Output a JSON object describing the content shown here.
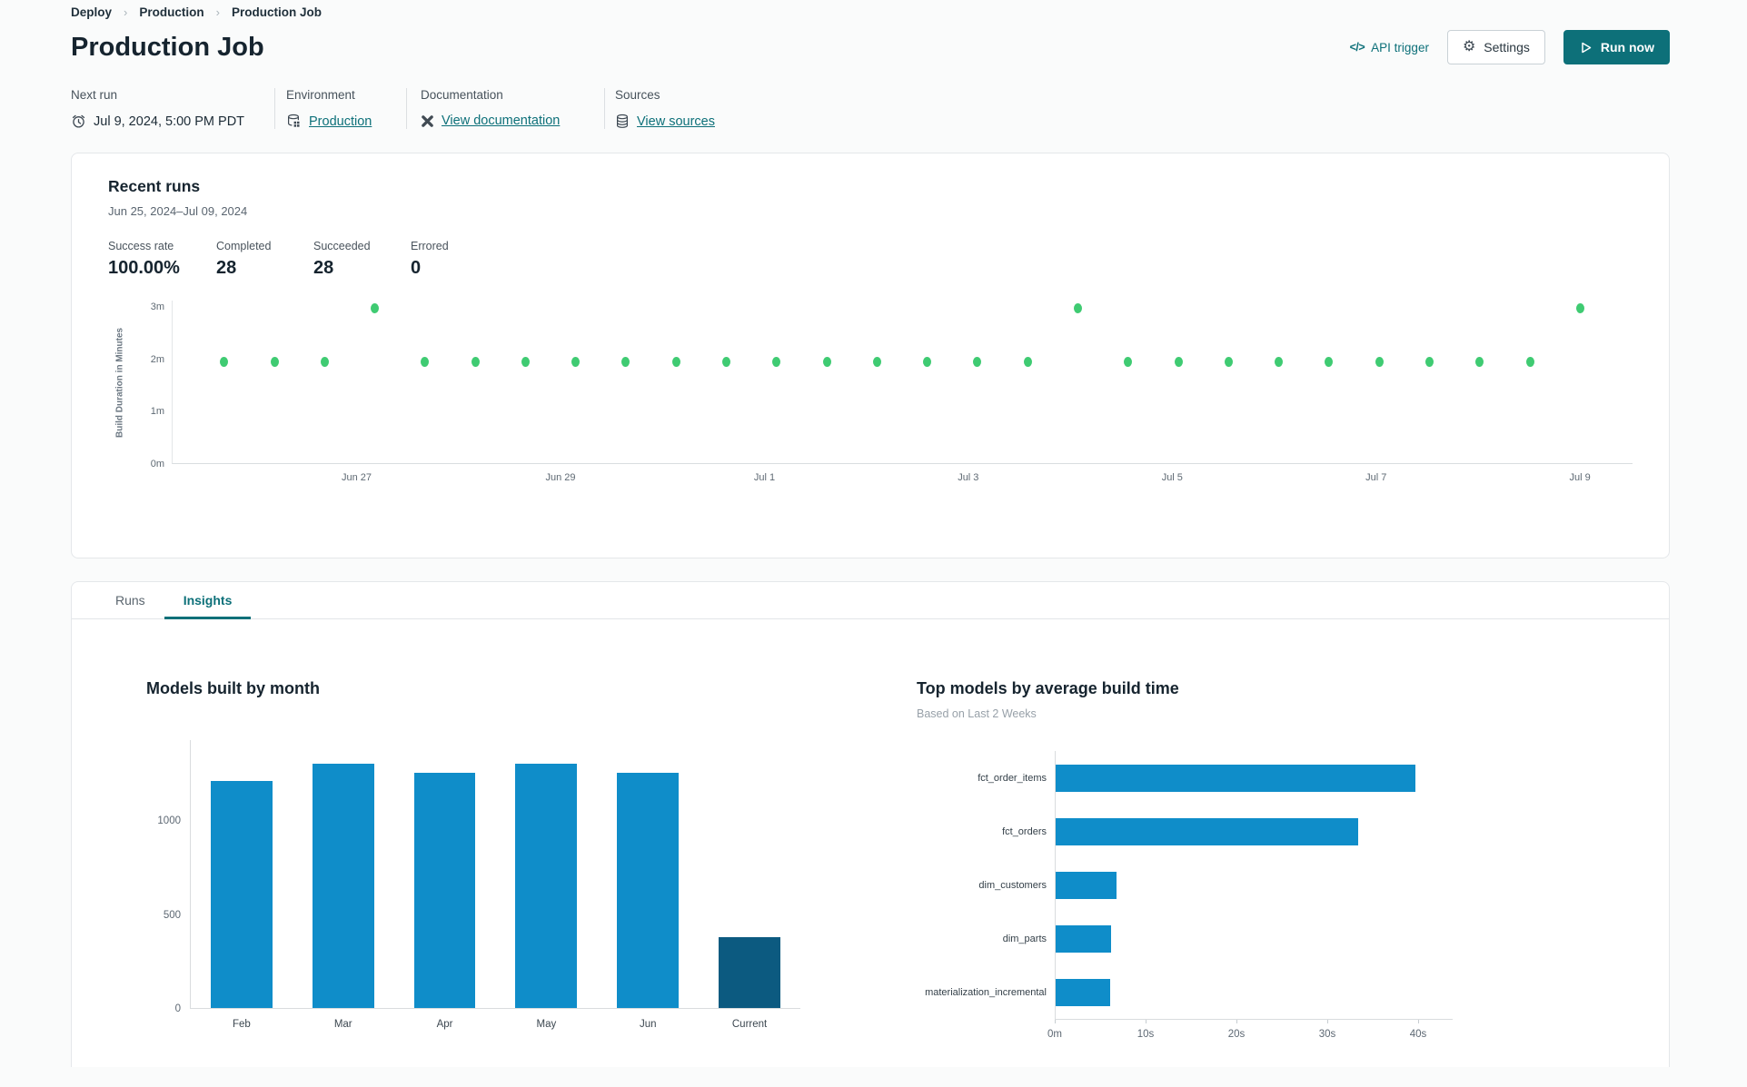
{
  "breadcrumb": {
    "items": [
      "Deploy",
      "Production",
      "Production Job"
    ]
  },
  "header": {
    "title": "Production Job",
    "api_trigger_label": "API trigger",
    "api_trigger_glyph": "</>",
    "settings_label": "Settings",
    "run_now_label": "Run now"
  },
  "info": {
    "columns": [
      {
        "label": "Next run",
        "value": "Jul 9, 2024, 5:00 PM PDT",
        "icon": "clock-icon"
      },
      {
        "label": "Environment",
        "value": "Production",
        "icon": "environment-icon"
      },
      {
        "label": "Documentation",
        "value": "View documentation",
        "icon": "dbt-logo-icon"
      },
      {
        "label": "Sources",
        "value": "View sources",
        "icon": "database-icon"
      }
    ]
  },
  "recent_runs": {
    "title": "Recent runs",
    "date_range": "Jun 25, 2024–Jul 09, 2024",
    "stats": [
      {
        "label": "Success rate",
        "value": "100.00%"
      },
      {
        "label": "Completed",
        "value": "28"
      },
      {
        "label": "Succeeded",
        "value": "28"
      },
      {
        "label": "Errored",
        "value": "0"
      }
    ]
  },
  "tabs": [
    {
      "label": "Runs",
      "active": false
    },
    {
      "label": "Insights",
      "active": true
    }
  ],
  "colors": {
    "accent_teal": "#0d7079",
    "success_green": "#3fcb72",
    "bar_blue": "#0f8dc9",
    "bar_dark_blue": "#0c5a80"
  },
  "chart_data": [
    {
      "id": "recent-runs-scatter",
      "type": "scatter",
      "ylabel": "Build Duration in Minutes",
      "yticks": [
        {
          "label": "0m",
          "minutes": 0
        },
        {
          "label": "1m",
          "minutes": 1
        },
        {
          "label": "2m",
          "minutes": 2
        },
        {
          "label": "3m",
          "minutes": 3
        }
      ],
      "ylim": [
        0,
        3.125
      ],
      "point_color": "#3fcb72",
      "points_minutes": [
        1.93,
        1.93,
        1.93,
        2.95,
        1.93,
        1.93,
        1.93,
        1.93,
        1.93,
        1.93,
        1.93,
        1.93,
        1.93,
        1.93,
        1.93,
        1.93,
        1.93,
        2.95,
        1.93,
        1.93,
        1.93,
        1.93,
        1.93,
        1.93,
        1.93,
        1.93,
        1.93,
        2.95
      ],
      "first_point_percent": 3.5,
      "point_spacing_percent": 3.44,
      "x_ticks": [
        {
          "label": "Jun 27",
          "percent": 12.6
        },
        {
          "label": "Jun 29",
          "percent": 26.57
        },
        {
          "label": "Jul 1",
          "percent": 40.54
        },
        {
          "label": "Jul 3",
          "percent": 54.5
        },
        {
          "label": "Jul 5",
          "percent": 68.47
        },
        {
          "label": "Jul 7",
          "percent": 82.44
        },
        {
          "label": "Jul 9",
          "percent": 96.4
        }
      ]
    },
    {
      "id": "models-built-by-month",
      "type": "bar",
      "title": "Models built by month",
      "categories": [
        "Feb",
        "Mar",
        "Apr",
        "May",
        "Jun",
        "Current"
      ],
      "values": [
        1210,
        1300,
        1250,
        1300,
        1250,
        375
      ],
      "bar_colors": [
        "#0f8dc9",
        "#0f8dc9",
        "#0f8dc9",
        "#0f8dc9",
        "#0f8dc9",
        "#0c5a80"
      ],
      "yticks": [
        0,
        500,
        1000
      ],
      "ylim": [
        0,
        1430
      ],
      "xlabel": "",
      "ylabel": ""
    },
    {
      "id": "top-models-by-avg-build-time",
      "type": "bar-horizontal",
      "title": "Top models by average build time",
      "subtitle": "Based on Last 2 Weeks",
      "categories": [
        "fct_order_items",
        "fct_orders",
        "dim_customers",
        "dim_parts",
        "materialization_incremental"
      ],
      "values_seconds": [
        39.6,
        33.3,
        6.7,
        6.1,
        6.0
      ],
      "bar_color": "#0f8dc9",
      "xticks": [
        {
          "label": "0m",
          "seconds": 0
        },
        {
          "label": "10s",
          "seconds": 10
        },
        {
          "label": "20s",
          "seconds": 20
        },
        {
          "label": "30s",
          "seconds": 30
        },
        {
          "label": "40s",
          "seconds": 40
        }
      ],
      "xlim": [
        0,
        43.8
      ]
    }
  ]
}
